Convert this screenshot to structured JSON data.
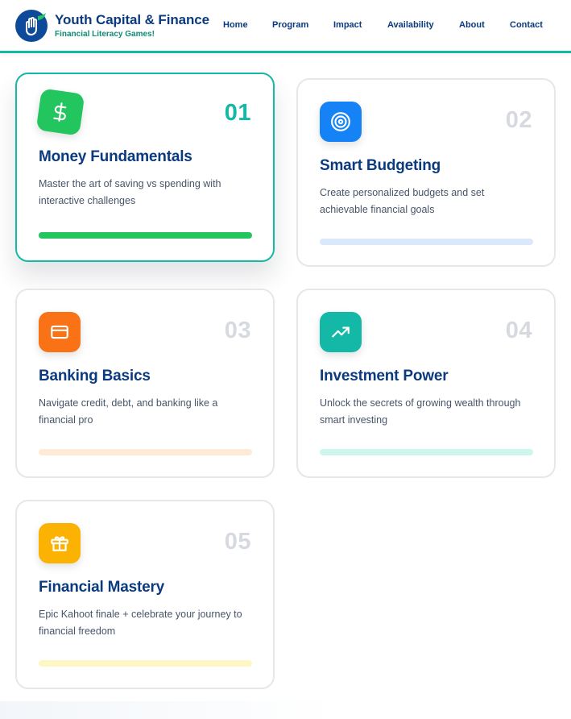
{
  "brand": {
    "title": "Youth Capital & Finance",
    "subtitle": "Financial Literacy Games!"
  },
  "nav": [
    {
      "label": "Home"
    },
    {
      "label": "Program"
    },
    {
      "label": "Impact"
    },
    {
      "label": "Availability"
    },
    {
      "label": "About"
    },
    {
      "label": "Contact"
    }
  ],
  "colors": {
    "primary": "#0b3a7e",
    "accent": "#14b8a6"
  },
  "cards": [
    {
      "number": "01",
      "title": "Money Fundamentals",
      "description": "Master the art of saving vs spending with interactive challenges",
      "icon": "dollar-icon",
      "icon_color": "#22c55e",
      "bar_color": "#22c55e",
      "progress": 1.0,
      "active": true
    },
    {
      "number": "02",
      "title": "Smart Budgeting",
      "description": "Create personalized budgets and set achievable financial goals",
      "icon": "target-icon",
      "icon_color": "#1583f5",
      "bar_color": "#dbe8fb",
      "progress": 0,
      "active": false
    },
    {
      "number": "03",
      "title": "Banking Basics",
      "description": "Navigate credit, debt, and banking like a financial pro",
      "icon": "credit-card-icon",
      "icon_color": "#f97316",
      "bar_color": "#fdebd7",
      "progress": 0,
      "active": false
    },
    {
      "number": "04",
      "title": "Investment Power",
      "description": "Unlock the secrets of growing wealth through smart investing",
      "icon": "trending-up-icon",
      "icon_color": "#14b8a6",
      "bar_color": "#cdf7ee",
      "progress": 0,
      "active": false
    },
    {
      "number": "05",
      "title": "Financial Mastery",
      "description": "Epic Kahoot finale + celebrate your journey to financial freedom",
      "icon": "gift-icon",
      "icon_color": "#fbb203",
      "bar_color": "#fef6c3",
      "progress": 0,
      "active": false
    }
  ]
}
